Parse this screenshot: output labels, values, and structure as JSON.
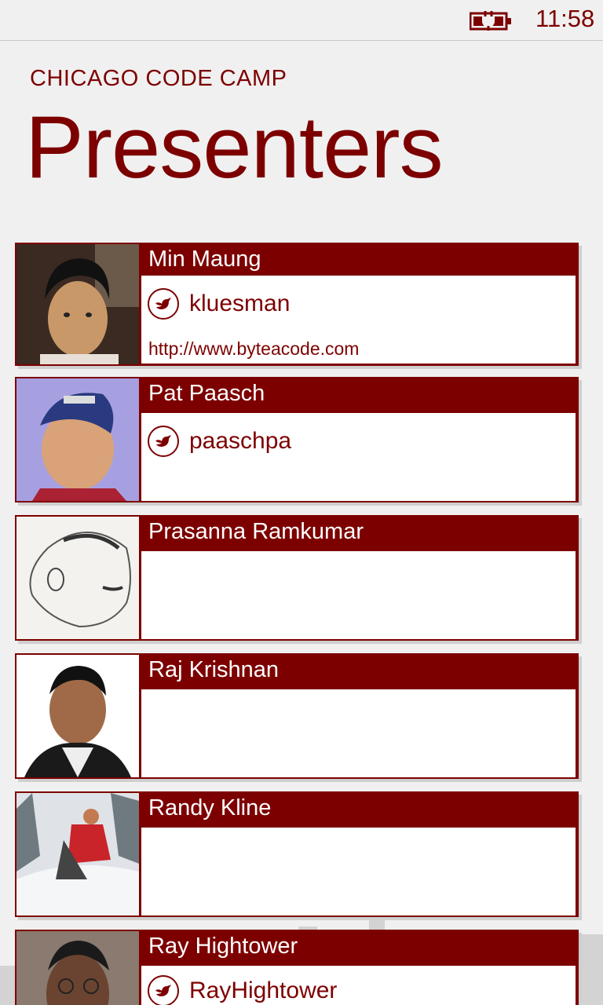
{
  "status": {
    "time": "11:58",
    "battery_icon": "battery-charging-icon"
  },
  "header": {
    "app_title": "CHICAGO CODE CAMP",
    "page_title": "Presenters"
  },
  "colors": {
    "accent": "#7d0000",
    "background": "#f0f0f0",
    "card_body": "#ffffff"
  },
  "presenters": [
    {
      "name": "Min Maung",
      "twitter": "kluesman",
      "url": "http://www.byteacode.com"
    },
    {
      "name": "Pat Paasch",
      "twitter": "paaschpa",
      "url": ""
    },
    {
      "name": "Prasanna Ramkumar",
      "twitter": "",
      "url": ""
    },
    {
      "name": "Raj Krishnan",
      "twitter": "",
      "url": ""
    },
    {
      "name": "Randy Kline",
      "twitter": "",
      "url": ""
    },
    {
      "name": "Ray Hightower",
      "twitter": "RayHightower",
      "url": ""
    }
  ]
}
